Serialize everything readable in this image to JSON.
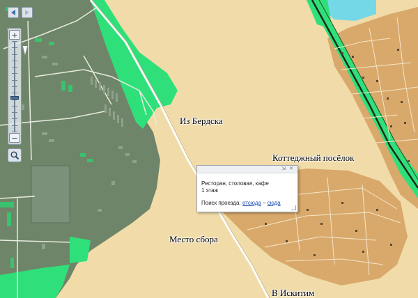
{
  "map": {
    "labels": {
      "from_berdsk": "Из Бердска",
      "cottage_village": "Коттеджный посёлок",
      "meeting_point": "Место сбора",
      "to_iskitim": "В Искитим"
    },
    "colors": {
      "land": "#f1dca9",
      "town_area": "#6f8569",
      "forest": "#2fe07a",
      "residential": "#d9a96b",
      "water": "#74d8e6",
      "railway": "#1c2a1c",
      "buildings": "#3ac26e"
    }
  },
  "controls": {
    "nav_left_icon": "arrow-left-icon",
    "nav_right_icon": "arrow-right-icon",
    "zoom_in_glyph": "+",
    "zoom_out_glyph": "−",
    "zoom_level_fraction": 0.62,
    "magnifier_icon": "magnifier-icon"
  },
  "popup": {
    "title": "Ресторан, столовая, кафе",
    "floor": "1 этаж",
    "route_label": "Поиск проезда:",
    "route_from": "отсюда",
    "route_separator": "–",
    "route_to": "сюда",
    "pin_icon": "pin-icon",
    "close_icon": "close-icon"
  }
}
